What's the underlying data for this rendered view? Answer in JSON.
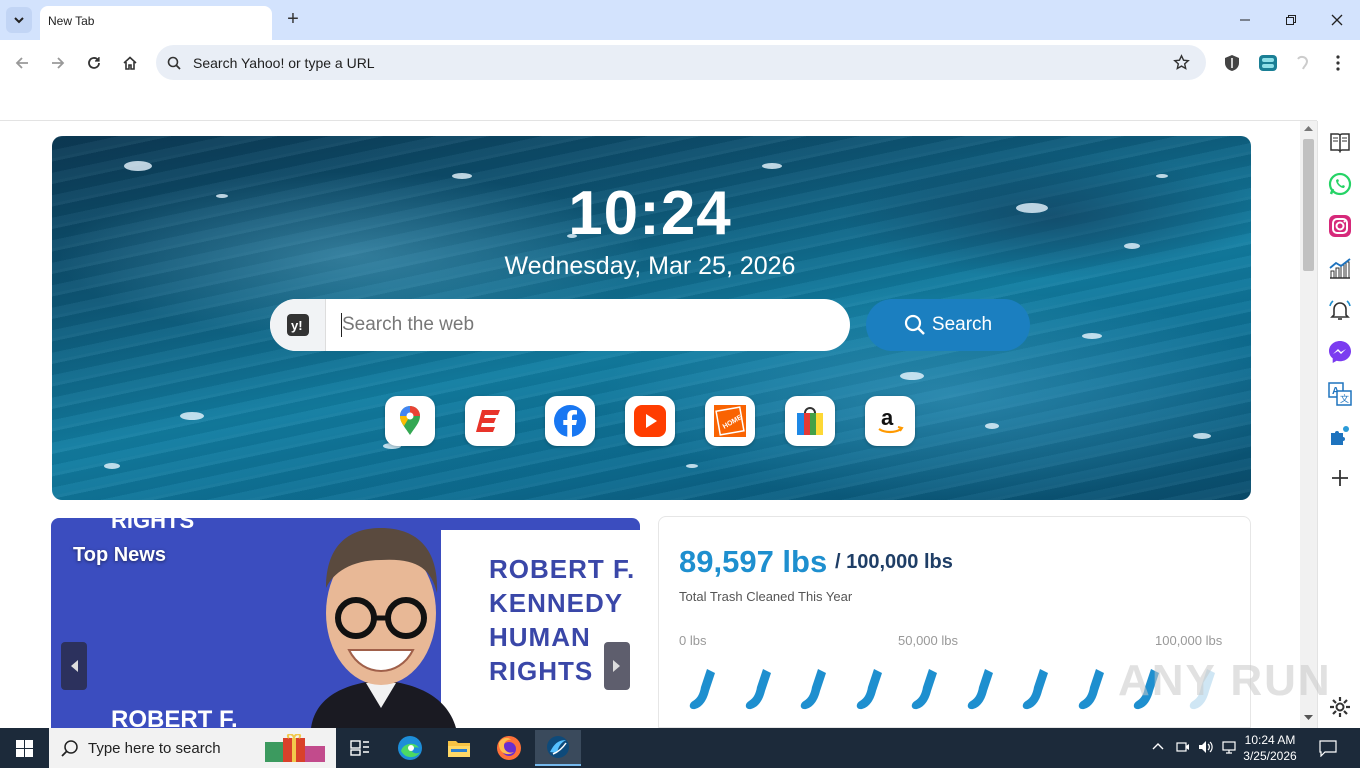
{
  "browser": {
    "tab_title": "New Tab",
    "omnibox_placeholder": "Search Yahoo! or type a URL"
  },
  "hero": {
    "time": "10:24",
    "date": "Wednesday, Mar 25, 2026",
    "search_placeholder": "Search the web",
    "search_button": "Search",
    "shortcuts": [
      "google-maps",
      "eventbrite",
      "facebook",
      "youtube",
      "home-depot",
      "microsoft-store",
      "amazon"
    ]
  },
  "news": {
    "title": "Top News",
    "sign_lines": [
      "ROBERT F.",
      "KENNEDY",
      "HUMAN",
      "RIGHTS"
    ],
    "sign_bottom": "ROBERT F.",
    "sign_top": "RIGHTS"
  },
  "trash": {
    "amount": "89,597 lbs",
    "goal": "/ 100,000 lbs",
    "caption": "Total Trash Cleaned This Year",
    "scale_min": "0 lbs",
    "scale_mid": "50,000 lbs",
    "scale_max": "100,000 lbs",
    "progress_fraction": 0.896,
    "accent": "#1e8fcf"
  },
  "sidepanel": {
    "icons": [
      "reading-list-icon",
      "whatsapp-icon",
      "instagram-icon",
      "chart-icon",
      "alarm-icon",
      "messenger-icon",
      "translate-icon",
      "puzzle-icon",
      "add-icon",
      "settings-icon"
    ]
  },
  "taskbar": {
    "search_placeholder": "Type here to search",
    "time": "10:24 AM",
    "date": "3/25/2026"
  },
  "watermark": "ANY RUN"
}
